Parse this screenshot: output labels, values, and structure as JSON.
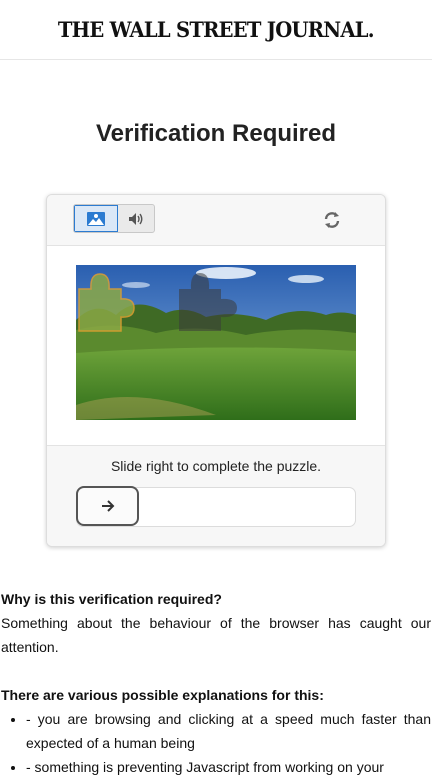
{
  "header": {
    "masthead": "THE WALL STREET JOURNAL."
  },
  "page": {
    "title": "Verification Required"
  },
  "captcha": {
    "modes": [
      {
        "icon": "image-icon",
        "selected": true
      },
      {
        "icon": "speaker-icon",
        "selected": false
      }
    ],
    "refresh_icon": "refresh-icon",
    "slider_icon": "arrow-right-icon",
    "instruction": "Slide right to complete the puzzle.",
    "slider_progress": 0,
    "accent_color": "#2b7bd1"
  },
  "explanation": {
    "question": "Why is this verification required?",
    "answer": "Something about the behaviour of the browser has caught our attention.",
    "list_heading": "There are various possible explanations for this:",
    "reasons": [
      "- you are browsing and clicking at a speed much faster than expected of a human being",
      "- something is preventing Javascript from working on your"
    ]
  }
}
